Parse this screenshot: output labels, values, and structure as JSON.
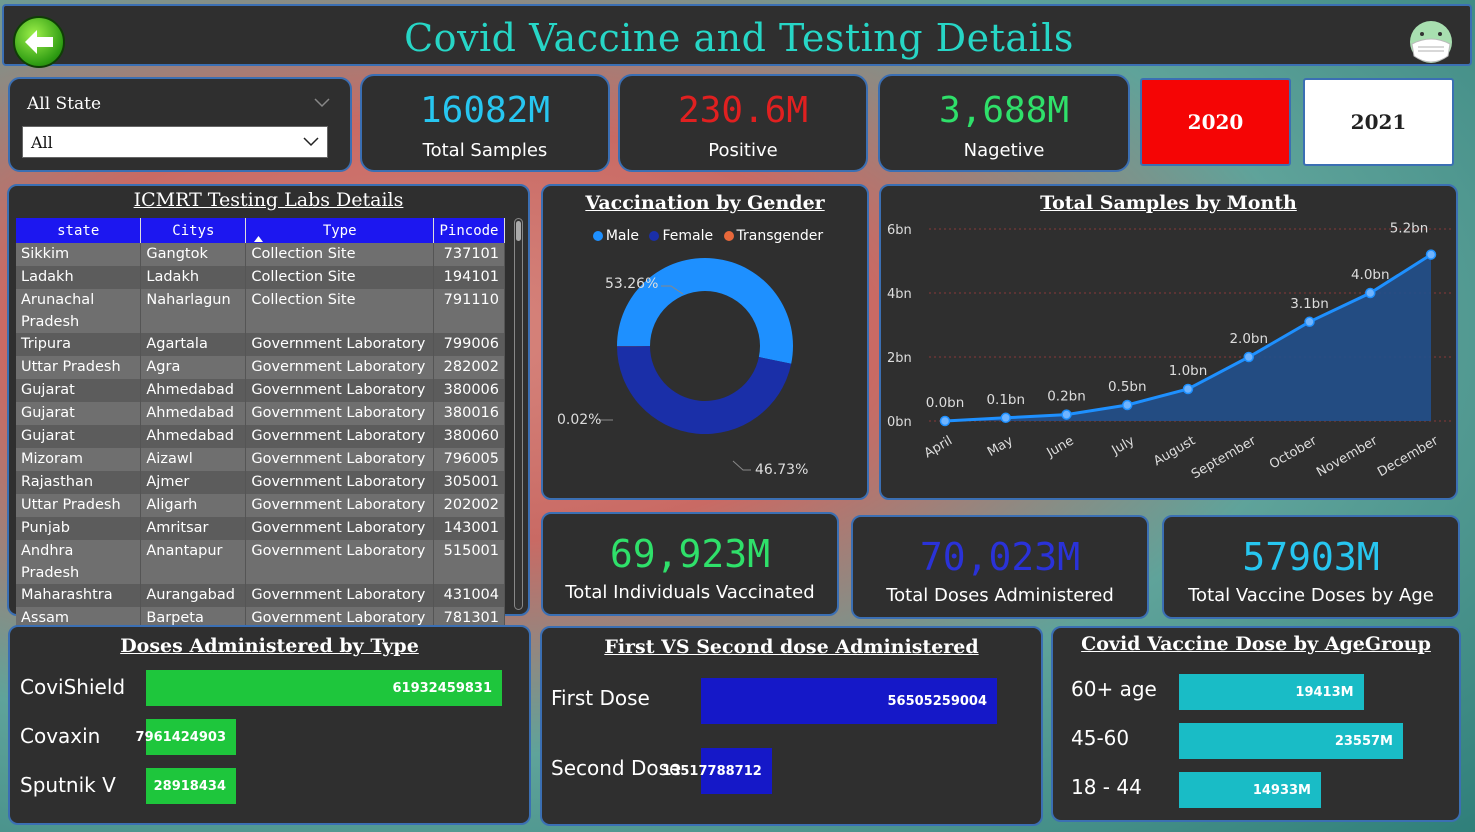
{
  "header": {
    "title": "Covid Vaccine and Testing Details"
  },
  "slicer": {
    "title": "All State",
    "value": "All"
  },
  "kpis": {
    "total_samples": {
      "value": "16082M",
      "label": "Total Samples",
      "color": "#27c6f0"
    },
    "positive": {
      "value": "230.6M",
      "label": "Positive",
      "color": "#e02020"
    },
    "negative": {
      "value": "3,688M",
      "label": "Nagetive",
      "color": "#2fe06a"
    }
  },
  "years": {
    "y2020": "2020",
    "y2021": "2021"
  },
  "labs": {
    "title": "ICMRT Testing Labs Details",
    "columns": [
      "state",
      "Citys",
      "Type",
      "Pincode"
    ],
    "rows": [
      [
        "Sikkim",
        "Gangtok",
        "Collection Site",
        "737101"
      ],
      [
        "Ladakh",
        "Ladakh",
        "Collection Site",
        "194101"
      ],
      [
        "Arunachal Pradesh",
        "Naharlagun",
        "Collection Site",
        "791110"
      ],
      [
        "Tripura",
        "Agartala",
        "Government Laboratory",
        "799006"
      ],
      [
        "Uttar Pradesh",
        "Agra",
        "Government Laboratory",
        "282002"
      ],
      [
        "Gujarat",
        "Ahmedabad",
        "Government Laboratory",
        "380006"
      ],
      [
        "Gujarat",
        "Ahmedabad",
        "Government Laboratory",
        "380016"
      ],
      [
        "Gujarat",
        "Ahmedabad",
        "Government Laboratory",
        "380060"
      ],
      [
        "Mizoram",
        "Aizawl",
        "Government Laboratory",
        "796005"
      ],
      [
        "Rajasthan",
        "Ajmer",
        "Government Laboratory",
        "305001"
      ],
      [
        "Uttar Pradesh",
        "Aligarh",
        "Government Laboratory",
        "202002"
      ],
      [
        "Punjab",
        "Amritsar",
        "Government Laboratory",
        "143001"
      ],
      [
        "Andhra Pradesh",
        "Anantapur",
        "Government Laboratory",
        "515001"
      ],
      [
        "Maharashtra",
        "Aurangabad",
        "Government Laboratory",
        "431004"
      ],
      [
        "Assam",
        "Barpeta",
        "Government Laboratory",
        "781301"
      ]
    ]
  },
  "gender": {
    "title": "Vaccination by Gender",
    "legend": [
      {
        "name": "Male",
        "color": "#1e90ff"
      },
      {
        "name": "Female",
        "color": "#1a2fa8"
      },
      {
        "name": "Transgender",
        "color": "#e8683a"
      }
    ],
    "slices": [
      {
        "name": "Male",
        "value": 53.26,
        "label": "53.26%",
        "color": "#1e90ff"
      },
      {
        "name": "Female",
        "value": 46.73,
        "label": "46.73%",
        "color": "#1a2fa8"
      },
      {
        "name": "Transgender",
        "value": 0.02,
        "label": "0.02%",
        "color": "#e8683a"
      }
    ]
  },
  "chart_data": {
    "type": "area",
    "title": "Total Samples by Month",
    "categories": [
      "April",
      "May",
      "June",
      "July",
      "August",
      "September",
      "October",
      "November",
      "December"
    ],
    "values": [
      0.0,
      0.1,
      0.2,
      0.5,
      1.0,
      2.0,
      3.1,
      4.0,
      5.2
    ],
    "data_labels": [
      "0.0bn",
      "0.1bn",
      "0.2bn",
      "0.5bn",
      "1.0bn",
      "2.0bn",
      "3.1bn",
      "4.0bn",
      "5.2bn"
    ],
    "yticks": [
      "0bn",
      "2bn",
      "4bn",
      "6bn"
    ],
    "ylim": [
      0,
      6
    ],
    "grid": true,
    "line_color": "#1e90ff",
    "fill_color": "#22508c"
  },
  "vacc_kpis": {
    "individuals": {
      "value": "69,923M",
      "label": "Total Individuals Vaccinated",
      "color": "#2fe06a"
    },
    "doses": {
      "value": "70,023M",
      "label": "Total Doses Administered",
      "color": "#2a32d8"
    },
    "by_age": {
      "value": "57903M",
      "label": "Total Vaccine Doses by Age",
      "color": "#27c6f0"
    }
  },
  "dose_type": {
    "title": "Doses Administered by Type",
    "color": "#1ec63c",
    "items": [
      {
        "label": "CoviShield",
        "value": 61932459831,
        "text": "61932459831"
      },
      {
        "label": "Covaxin",
        "value": 7961424903,
        "text": "7961424903"
      },
      {
        "label": "Sputnik V",
        "value": 28918434,
        "text": "28918434"
      }
    ]
  },
  "dose_order": {
    "title": "First VS Second dose Administered ",
    "color": "#1518c8",
    "items": [
      {
        "label": "First Dose",
        "value": 56505259004,
        "text": "56505259004"
      },
      {
        "label": "Second Dose",
        "value": 13517788712,
        "text": "13517788712"
      }
    ]
  },
  "age_group": {
    "title": "Covid Vaccine Dose by AgeGroup ",
    "color": "#19bcc6",
    "items": [
      {
        "label": "60+ age",
        "value": 19413,
        "text": "19413M"
      },
      {
        "label": "45-60",
        "value": 23557,
        "text": "23557M"
      },
      {
        "label": "18 - 44",
        "value": 14933,
        "text": "14933M"
      }
    ]
  }
}
